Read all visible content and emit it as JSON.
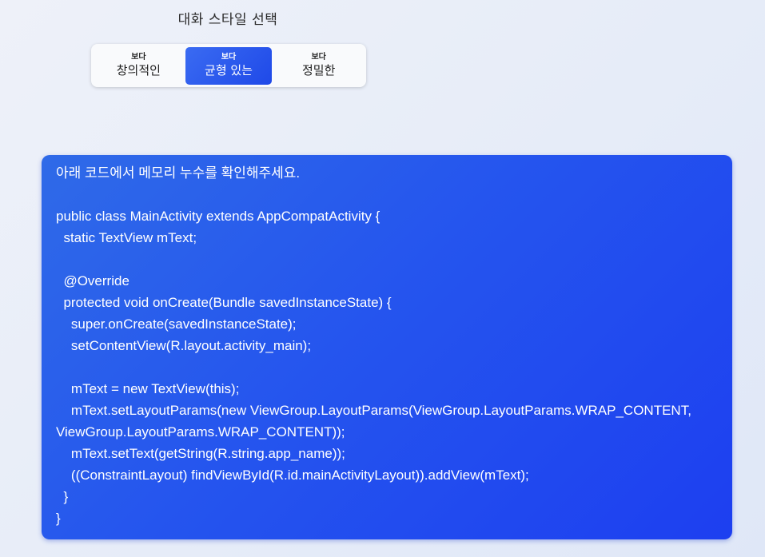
{
  "style_selector": {
    "title": "대화 스타일 선택",
    "options": [
      {
        "prefix": "보다",
        "label": "창의적인",
        "selected": false
      },
      {
        "prefix": "보다",
        "label": "균형 있는",
        "selected": true
      },
      {
        "prefix": "보다",
        "label": "정밀한",
        "selected": false
      }
    ]
  },
  "message": {
    "text": "아래 코드에서 메모리 누수를 확인해주세요.\n\npublic class MainActivity extends AppCompatActivity {\n  static TextView mText;\n\n  @Override\n  protected void onCreate(Bundle savedInstanceState) {\n    super.onCreate(savedInstanceState);\n    setContentView(R.layout.activity_main);\n\n    mText = new TextView(this);\n    mText.setLayoutParams(new ViewGroup.LayoutParams(ViewGroup.LayoutParams.WRAP_CONTENT, ViewGroup.LayoutParams.WRAP_CONTENT));\n    mText.setText(getString(R.string.app_name));\n    ((ConstraintLayout) findViewById(R.id.mainActivityLayout)).addView(mText);\n  }\n}"
  },
  "colors": {
    "accent": "#2555ee",
    "bubble_start": "#2f6ae8",
    "bubble_end": "#1d3ff0"
  }
}
